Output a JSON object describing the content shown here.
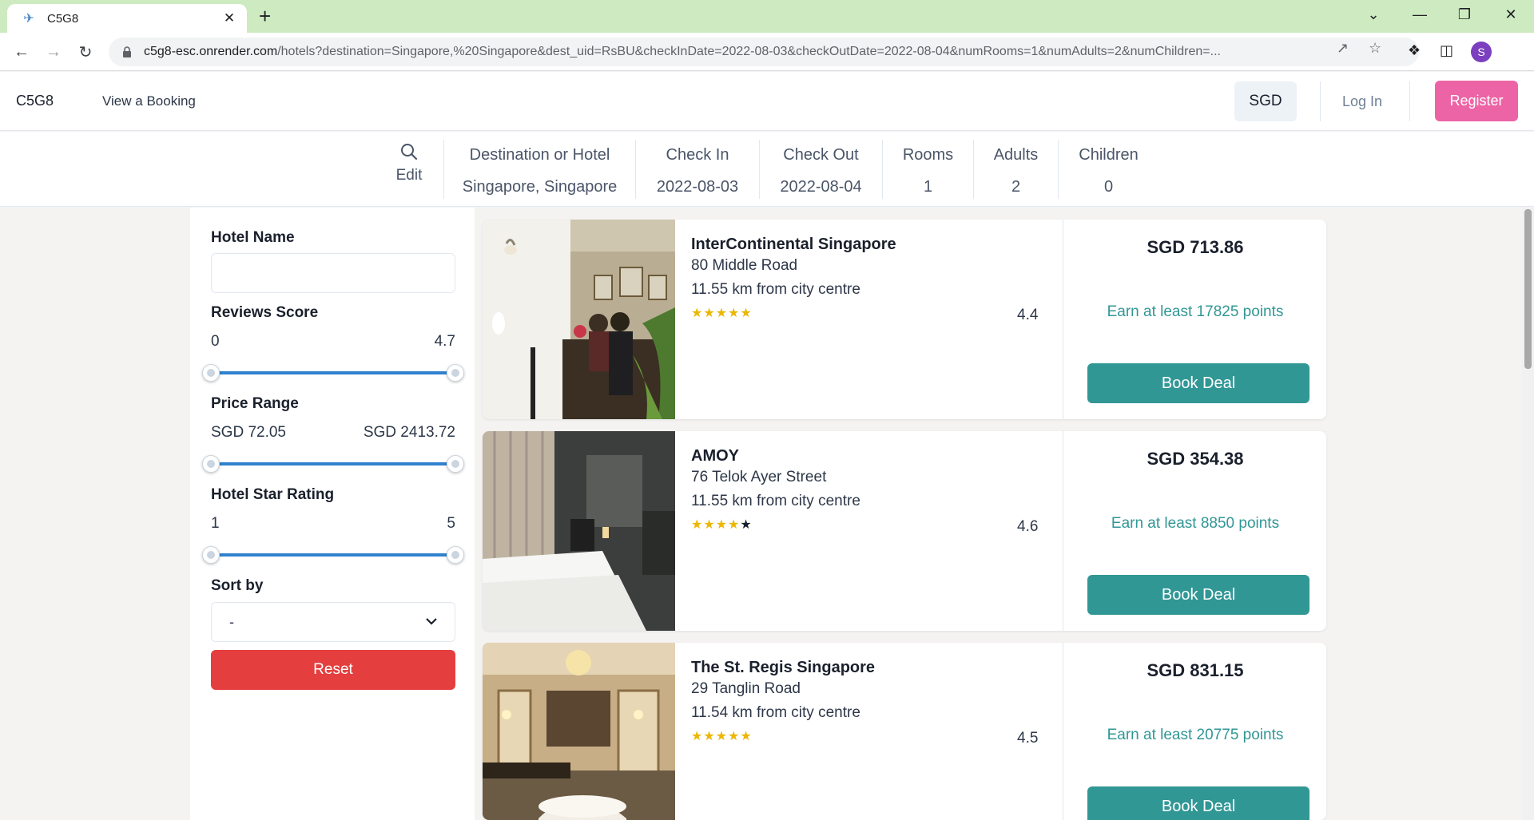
{
  "browser": {
    "tab_title": "C5G8",
    "url_host": "c5g8-esc.onrender.com",
    "url_rest": "/hotels?destination=Singapore,%20Singapore&dest_uid=RsBU&checkInDate=2022-08-03&checkOutDate=2022-08-04&numRooms=1&numAdults=2&numChildren=...",
    "profile_initial": "S"
  },
  "header": {
    "brand": "C5G8",
    "view_booking": "View a Booking",
    "currency": "SGD",
    "login": "Log In",
    "register": "Register"
  },
  "search": {
    "edit_label": "Edit",
    "fields": [
      {
        "label": "Destination or Hotel",
        "value": "Singapore, Singapore"
      },
      {
        "label": "Check In",
        "value": "2022-08-03"
      },
      {
        "label": "Check Out",
        "value": "2022-08-04"
      },
      {
        "label": "Rooms",
        "value": "1"
      },
      {
        "label": "Adults",
        "value": "2"
      },
      {
        "label": "Children",
        "value": "0"
      }
    ]
  },
  "filters": {
    "hotel_name_label": "Hotel Name",
    "hotel_name_value": "",
    "reviews_label": "Reviews Score",
    "reviews_min": "0",
    "reviews_max": "4.7",
    "price_label": "Price Range",
    "price_min": "SGD 72.05",
    "price_max": "SGD 2413.72",
    "stars_label": "Hotel Star Rating",
    "stars_min": "1",
    "stars_max": "5",
    "sort_label": "Sort by",
    "sort_value": "-",
    "reset_label": "Reset"
  },
  "hotels": [
    {
      "name": "InterContinental Singapore",
      "address": "80 Middle Road",
      "distance": "11.55 km from city centre",
      "stars": 5,
      "score": "4.4",
      "price": "SGD 713.86",
      "points": "Earn at least 17825 points",
      "button": "Book Deal"
    },
    {
      "name": "AMOY",
      "address": "76 Telok Ayer Street",
      "distance": "11.55 km from city centre",
      "stars": 4,
      "score": "4.6",
      "price": "SGD 354.38",
      "points": "Earn at least 8850 points",
      "button": "Book Deal"
    },
    {
      "name": "The St. Regis Singapore",
      "address": "29 Tanglin Road",
      "distance": "11.54 km from city centre",
      "stars": 5,
      "score": "4.5",
      "price": "SGD 831.15",
      "points": "Earn at least 20775 points",
      "button": "Book Deal"
    }
  ],
  "colors": {
    "accent_teal": "#319795",
    "register_pink": "#ed64a6",
    "reset_red": "#e53e3e",
    "slider_blue": "#3182ce",
    "star_gold": "#ecb700"
  }
}
